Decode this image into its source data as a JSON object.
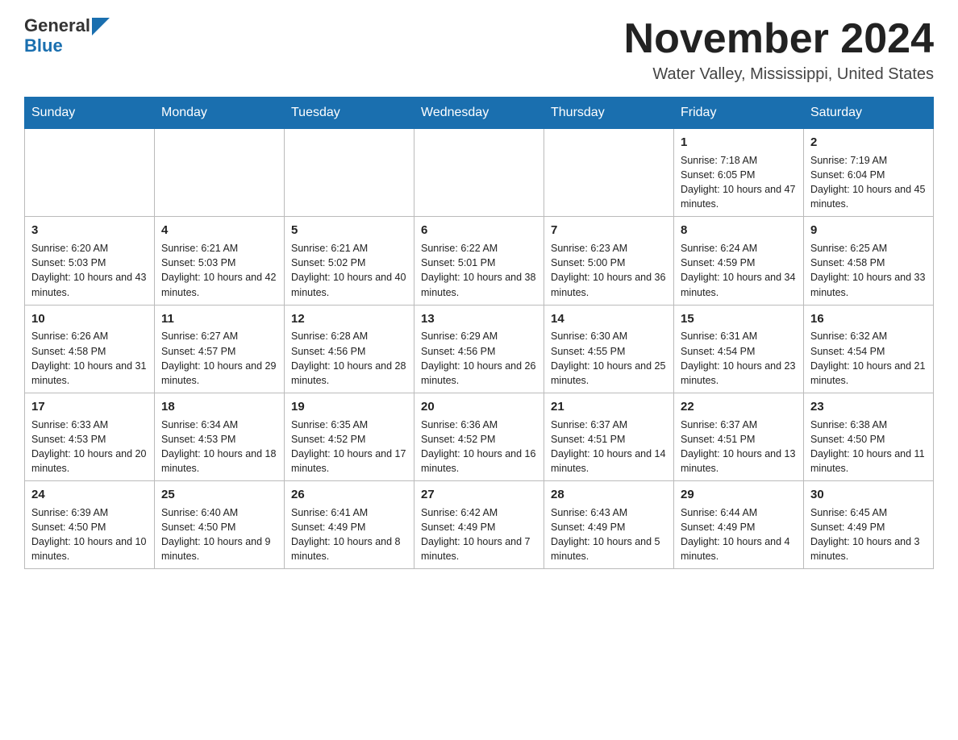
{
  "logo": {
    "line1": "General",
    "triangle_char": "▶",
    "line2": "Blue"
  },
  "title": "November 2024",
  "location": "Water Valley, Mississippi, United States",
  "days_of_week": [
    "Sunday",
    "Monday",
    "Tuesday",
    "Wednesday",
    "Thursday",
    "Friday",
    "Saturday"
  ],
  "weeks": [
    [
      {
        "day": "",
        "info": ""
      },
      {
        "day": "",
        "info": ""
      },
      {
        "day": "",
        "info": ""
      },
      {
        "day": "",
        "info": ""
      },
      {
        "day": "",
        "info": ""
      },
      {
        "day": "1",
        "info": "Sunrise: 7:18 AM\nSunset: 6:05 PM\nDaylight: 10 hours and 47 minutes."
      },
      {
        "day": "2",
        "info": "Sunrise: 7:19 AM\nSunset: 6:04 PM\nDaylight: 10 hours and 45 minutes."
      }
    ],
    [
      {
        "day": "3",
        "info": "Sunrise: 6:20 AM\nSunset: 5:03 PM\nDaylight: 10 hours and 43 minutes."
      },
      {
        "day": "4",
        "info": "Sunrise: 6:21 AM\nSunset: 5:03 PM\nDaylight: 10 hours and 42 minutes."
      },
      {
        "day": "5",
        "info": "Sunrise: 6:21 AM\nSunset: 5:02 PM\nDaylight: 10 hours and 40 minutes."
      },
      {
        "day": "6",
        "info": "Sunrise: 6:22 AM\nSunset: 5:01 PM\nDaylight: 10 hours and 38 minutes."
      },
      {
        "day": "7",
        "info": "Sunrise: 6:23 AM\nSunset: 5:00 PM\nDaylight: 10 hours and 36 minutes."
      },
      {
        "day": "8",
        "info": "Sunrise: 6:24 AM\nSunset: 4:59 PM\nDaylight: 10 hours and 34 minutes."
      },
      {
        "day": "9",
        "info": "Sunrise: 6:25 AM\nSunset: 4:58 PM\nDaylight: 10 hours and 33 minutes."
      }
    ],
    [
      {
        "day": "10",
        "info": "Sunrise: 6:26 AM\nSunset: 4:58 PM\nDaylight: 10 hours and 31 minutes."
      },
      {
        "day": "11",
        "info": "Sunrise: 6:27 AM\nSunset: 4:57 PM\nDaylight: 10 hours and 29 minutes."
      },
      {
        "day": "12",
        "info": "Sunrise: 6:28 AM\nSunset: 4:56 PM\nDaylight: 10 hours and 28 minutes."
      },
      {
        "day": "13",
        "info": "Sunrise: 6:29 AM\nSunset: 4:56 PM\nDaylight: 10 hours and 26 minutes."
      },
      {
        "day": "14",
        "info": "Sunrise: 6:30 AM\nSunset: 4:55 PM\nDaylight: 10 hours and 25 minutes."
      },
      {
        "day": "15",
        "info": "Sunrise: 6:31 AM\nSunset: 4:54 PM\nDaylight: 10 hours and 23 minutes."
      },
      {
        "day": "16",
        "info": "Sunrise: 6:32 AM\nSunset: 4:54 PM\nDaylight: 10 hours and 21 minutes."
      }
    ],
    [
      {
        "day": "17",
        "info": "Sunrise: 6:33 AM\nSunset: 4:53 PM\nDaylight: 10 hours and 20 minutes."
      },
      {
        "day": "18",
        "info": "Sunrise: 6:34 AM\nSunset: 4:53 PM\nDaylight: 10 hours and 18 minutes."
      },
      {
        "day": "19",
        "info": "Sunrise: 6:35 AM\nSunset: 4:52 PM\nDaylight: 10 hours and 17 minutes."
      },
      {
        "day": "20",
        "info": "Sunrise: 6:36 AM\nSunset: 4:52 PM\nDaylight: 10 hours and 16 minutes."
      },
      {
        "day": "21",
        "info": "Sunrise: 6:37 AM\nSunset: 4:51 PM\nDaylight: 10 hours and 14 minutes."
      },
      {
        "day": "22",
        "info": "Sunrise: 6:37 AM\nSunset: 4:51 PM\nDaylight: 10 hours and 13 minutes."
      },
      {
        "day": "23",
        "info": "Sunrise: 6:38 AM\nSunset: 4:50 PM\nDaylight: 10 hours and 11 minutes."
      }
    ],
    [
      {
        "day": "24",
        "info": "Sunrise: 6:39 AM\nSunset: 4:50 PM\nDaylight: 10 hours and 10 minutes."
      },
      {
        "day": "25",
        "info": "Sunrise: 6:40 AM\nSunset: 4:50 PM\nDaylight: 10 hours and 9 minutes."
      },
      {
        "day": "26",
        "info": "Sunrise: 6:41 AM\nSunset: 4:49 PM\nDaylight: 10 hours and 8 minutes."
      },
      {
        "day": "27",
        "info": "Sunrise: 6:42 AM\nSunset: 4:49 PM\nDaylight: 10 hours and 7 minutes."
      },
      {
        "day": "28",
        "info": "Sunrise: 6:43 AM\nSunset: 4:49 PM\nDaylight: 10 hours and 5 minutes."
      },
      {
        "day": "29",
        "info": "Sunrise: 6:44 AM\nSunset: 4:49 PM\nDaylight: 10 hours and 4 minutes."
      },
      {
        "day": "30",
        "info": "Sunrise: 6:45 AM\nSunset: 4:49 PM\nDaylight: 10 hours and 3 minutes."
      }
    ]
  ]
}
